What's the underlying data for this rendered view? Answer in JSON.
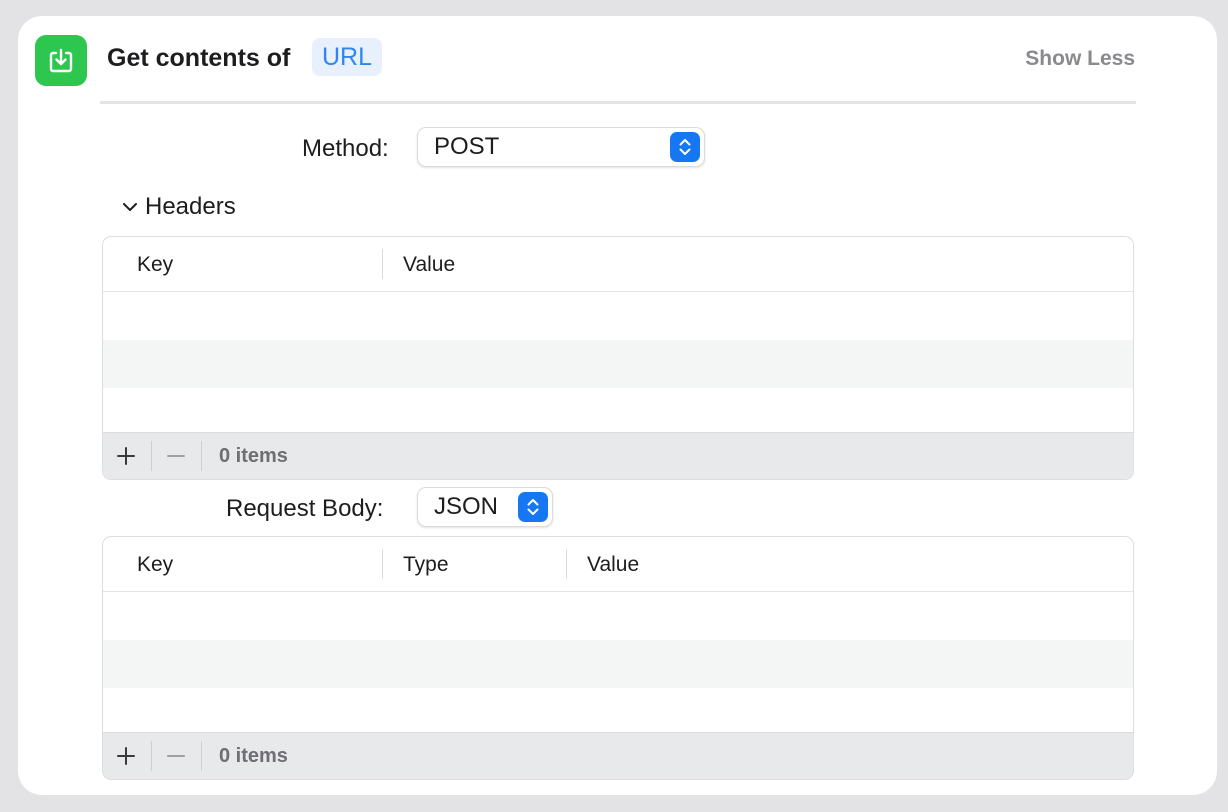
{
  "action": {
    "icon": "download-tray-icon",
    "title": "Get contents of",
    "url_token": "URL",
    "show_less_label": "Show Less"
  },
  "method": {
    "label": "Method:",
    "value": "POST"
  },
  "headers": {
    "section_label": "Headers",
    "columns": [
      "Key",
      "Value"
    ],
    "items_count": "0 items"
  },
  "request_body": {
    "label": "Request Body:",
    "value": "JSON",
    "columns": [
      "Key",
      "Type",
      "Value"
    ],
    "items_count": "0 items"
  },
  "colors": {
    "icon_background": "#2dc74f",
    "accent": "#1677f2",
    "url_token_text": "#2f86f2"
  }
}
